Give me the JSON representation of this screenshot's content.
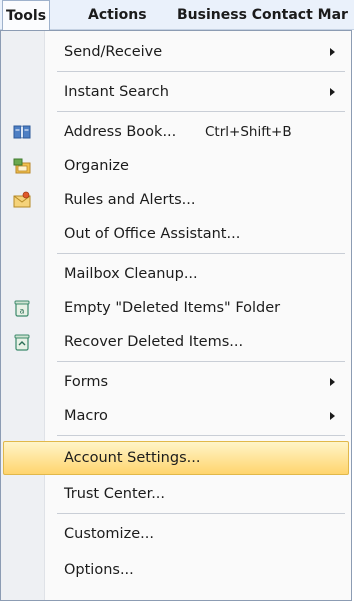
{
  "menubar": {
    "items": [
      "Tools",
      "Actions",
      "Business Contact Mar"
    ]
  },
  "menu": {
    "items": [
      {
        "label": "Send/Receive",
        "icon": "",
        "shortcut": "",
        "submenu": true
      },
      {
        "label": "Instant Search",
        "icon": "",
        "shortcut": "",
        "submenu": true
      },
      {
        "label": "Address Book...",
        "icon": "address-book-icon",
        "shortcut": "Ctrl+Shift+B",
        "submenu": false
      },
      {
        "label": "Organize",
        "icon": "organize-icon",
        "shortcut": "",
        "submenu": false
      },
      {
        "label": "Rules and Alerts...",
        "icon": "rules-alerts-icon",
        "shortcut": "",
        "submenu": false
      },
      {
        "label": "Out of Office Assistant...",
        "icon": "",
        "shortcut": "",
        "submenu": false
      },
      {
        "label": "Mailbox Cleanup...",
        "icon": "",
        "shortcut": "",
        "submenu": false
      },
      {
        "label": "Empty \"Deleted Items\" Folder",
        "icon": "empty-deleted-items-icon",
        "shortcut": "",
        "submenu": false
      },
      {
        "label": "Recover Deleted Items...",
        "icon": "recover-deleted-items-icon",
        "shortcut": "",
        "submenu": false
      },
      {
        "label": "Forms",
        "icon": "",
        "shortcut": "",
        "submenu": true
      },
      {
        "label": "Macro",
        "icon": "",
        "shortcut": "",
        "submenu": true
      },
      {
        "label": "Account Settings...",
        "icon": "",
        "shortcut": "",
        "submenu": false,
        "highlighted": true
      },
      {
        "label": "Trust Center...",
        "icon": "",
        "shortcut": "",
        "submenu": false
      },
      {
        "label": "Customize...",
        "icon": "",
        "shortcut": "",
        "submenu": false
      },
      {
        "label": "Options...",
        "icon": "",
        "shortcut": "",
        "submenu": false
      }
    ]
  },
  "colors": {
    "highlight_top": "#fff5c8",
    "highlight_bottom": "#ffd56e",
    "menubar_bg": "#eaf1fb"
  }
}
